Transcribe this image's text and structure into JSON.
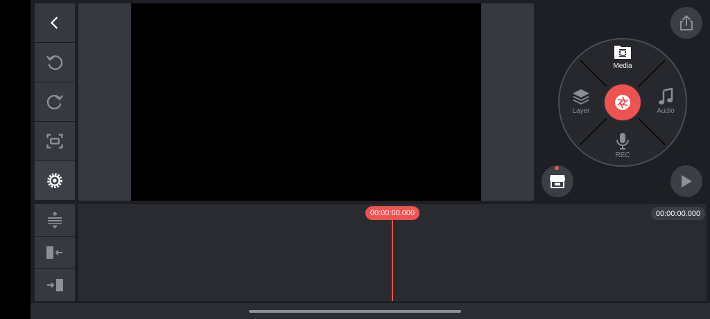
{
  "toolbar": {
    "items": [
      {
        "name": "back-button",
        "icon": "chevron-left-icon"
      },
      {
        "name": "undo-button",
        "icon": "undo-icon"
      },
      {
        "name": "redo-button",
        "icon": "redo-icon"
      },
      {
        "name": "aspect-ratio-button",
        "icon": "aspect-ratio-icon"
      },
      {
        "name": "settings-button",
        "icon": "gear-icon"
      }
    ]
  },
  "wheel": {
    "media_label": "Media",
    "layer_label": "Layer",
    "audio_label": "Audio",
    "rec_label": "REC"
  },
  "timeline": {
    "playhead_time": "00:00:00.000",
    "total_time": "00:00:00.000"
  },
  "colors": {
    "accent": "#ef5350",
    "panel": "#363940",
    "background": "#1e1f24"
  }
}
